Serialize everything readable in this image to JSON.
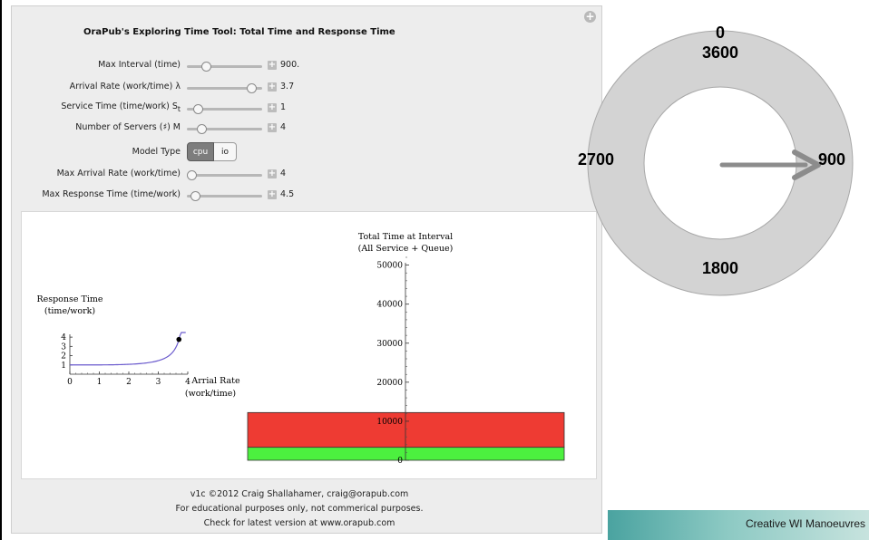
{
  "app": {
    "title": "OraPub's Exploring Time Tool: Total Time and Response Time",
    "expand_icon": "plus-circle-icon"
  },
  "controls": {
    "max_interval": {
      "label": "Max Interval (time)",
      "value": "900.",
      "fraction": 0.22
    },
    "arrival_rate": {
      "label": "Arrival Rate (work/time) λ",
      "value": "3.7",
      "fraction": 0.92
    },
    "service_time": {
      "label": "Service Time (time/work) S",
      "label_sub": "t",
      "value": "1",
      "fraction": 0.1
    },
    "servers": {
      "label": "Number of Servers (♯) M",
      "value": "4",
      "fraction": 0.15
    },
    "model_type": {
      "label": "Model Type",
      "options": [
        "cpu",
        "io"
      ],
      "selected": "cpu"
    },
    "max_arrival_rate": {
      "label": "Max Arrival Rate (work/time)",
      "value": "4",
      "fraction": 0.0
    },
    "max_response_time": {
      "label": "Max Response Time (time/work)",
      "value": "4.5",
      "fraction": 0.05
    }
  },
  "chart_data": [
    {
      "type": "line",
      "ylabel_lines": [
        "Response Time",
        "(time/work)"
      ],
      "xlabel_lines": [
        "Arrial Rate",
        "(work/time)"
      ],
      "xlim": [
        0,
        4
      ],
      "ylim": [
        0,
        4.5
      ],
      "x_ticks": [
        "0",
        "1",
        "2",
        "3",
        "4"
      ],
      "y_ticks": [
        "1",
        "2",
        "3",
        "4"
      ],
      "curve": {
        "servers": 4,
        "service_time": 1,
        "x_max": 3.93
      },
      "current_point": {
        "x": 3.7,
        "y": 3.75
      },
      "colors": {
        "curve": "#6a5acd",
        "point": "#000000"
      }
    },
    {
      "type": "bar",
      "title_lines": [
        "Total Time at Interval",
        "(All Service + Queue)"
      ],
      "ylim": [
        0,
        52000
      ],
      "y_ticks": [
        "0",
        "10000",
        "20000",
        "30000",
        "40000",
        "50000"
      ],
      "series": [
        {
          "name": "Service",
          "values": [
            3330
          ],
          "color": "#4cf03f"
        },
        {
          "name": "Queue",
          "values": [
            8900
          ],
          "color": "#ee3b33"
        }
      ]
    }
  ],
  "footer": {
    "line1": "v1c ©2012 Craig Shallahamer, craig@orapub.com",
    "line2": "For educational purposes only, not commerical purposes.",
    "line3": "Check for latest version at www.orapub.com"
  },
  "dial": {
    "top0": "0",
    "top": "3600",
    "right": "900",
    "bottom": "1800",
    "left": "2700",
    "pointer_value": 900,
    "ring_color": "#d3d3d3",
    "arrow_color": "#8c8c8c"
  },
  "banner": {
    "text": "Creative WI Manoeuvres"
  }
}
